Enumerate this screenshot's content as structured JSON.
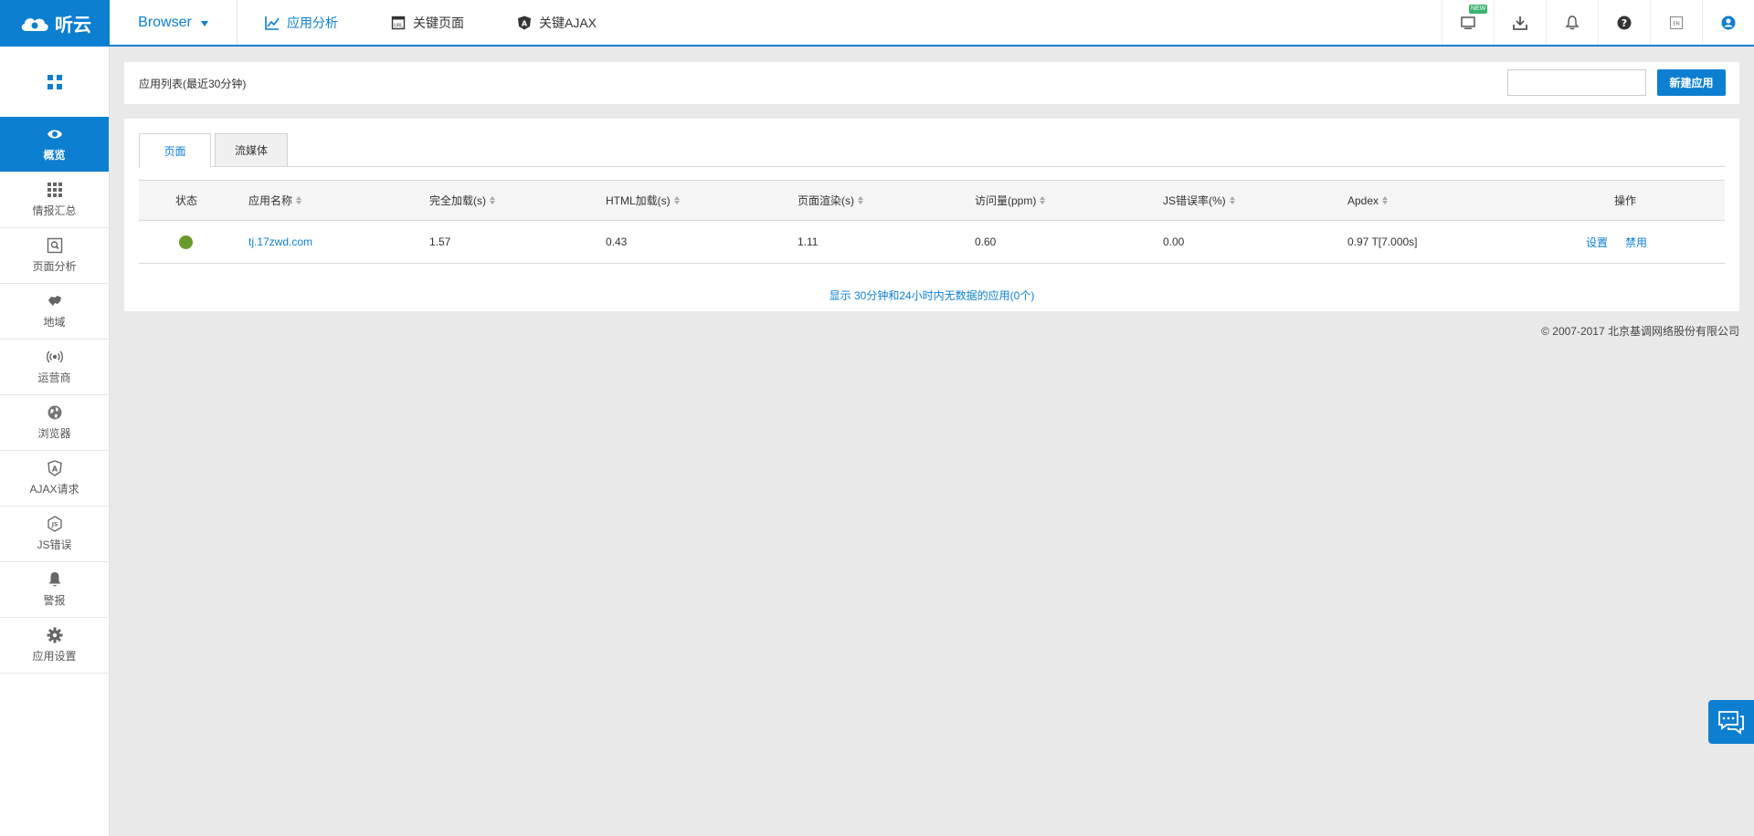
{
  "header": {
    "logo_text": "听云",
    "product": "Browser",
    "nav": [
      {
        "label": "应用分析",
        "icon": "chart-line-icon"
      },
      {
        "label": "关键页面",
        "icon": "url-page-icon"
      },
      {
        "label": "关键AJAX",
        "icon": "angular-shield-icon"
      }
    ],
    "tools": [
      "monitor-icon",
      "download-icon",
      "bell-icon",
      "help-icon",
      "language-en-icon",
      "user-icon"
    ],
    "new_badge": "NEW",
    "lang_label": "EN"
  },
  "sidebar": {
    "items": [
      {
        "label": "概览",
        "icon": "eye-icon"
      },
      {
        "label": "情报汇总",
        "icon": "grid-icon"
      },
      {
        "label": "页面分析",
        "icon": "page-search-icon"
      },
      {
        "label": "地域",
        "icon": "map-icon"
      },
      {
        "label": "运营商",
        "icon": "signal-icon"
      },
      {
        "label": "浏览器",
        "icon": "globe-icon"
      },
      {
        "label": "AJAX请求",
        "icon": "angular-icon"
      },
      {
        "label": "JS错误",
        "icon": "js-icon"
      },
      {
        "label": "警报",
        "icon": "bell-icon"
      },
      {
        "label": "应用设置",
        "icon": "gear-icon"
      }
    ]
  },
  "app_list": {
    "title": "应用列表(最近30分钟)",
    "search_placeholder": "",
    "new_button": "新建应用"
  },
  "tabs": [
    "页面",
    "流媒体"
  ],
  "table": {
    "columns": [
      "状态",
      "应用名称",
      "完全加载(s)",
      "HTML加载(s)",
      "页面渲染(s)",
      "访问量(ppm)",
      "JS错误率(%)",
      "Apdex",
      "操作"
    ],
    "rows": [
      {
        "status": "good",
        "name": "tj.17zwd.com",
        "full_load": "1.57",
        "html_load": "0.43",
        "render": "1.11",
        "ppm": "0.60",
        "js_error": "0.00",
        "apdex": "0.97 T[7.000s]",
        "action_settings": "设置",
        "action_disable": "禁用"
      }
    ],
    "footer_link": "显示 30分钟和24小时内无数据的应用(0个)"
  },
  "copyright": "© 2007-2017  北京基调网络股份有限公司",
  "colors": {
    "primary": "#0d7fd0",
    "status_good": "#6a9a2a"
  }
}
